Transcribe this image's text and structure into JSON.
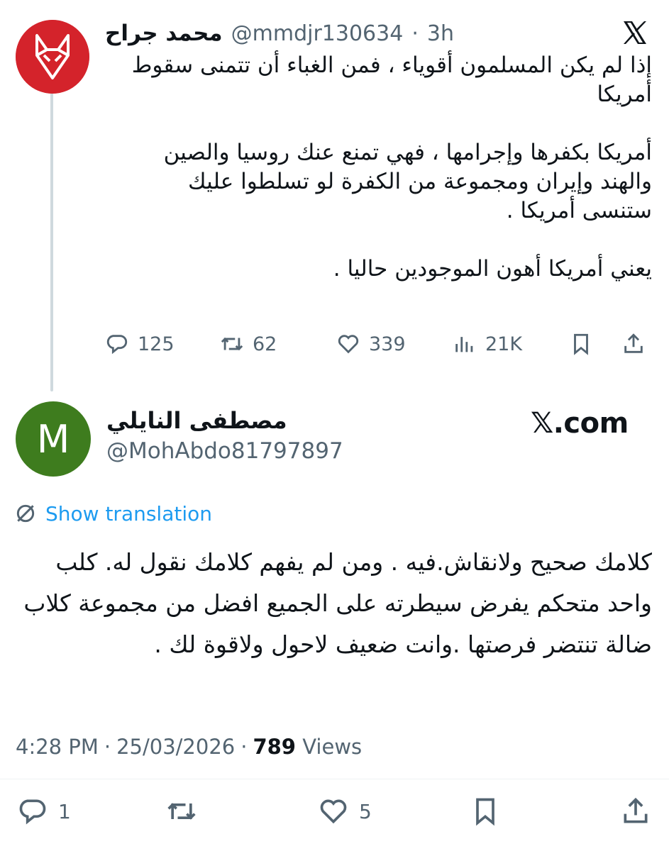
{
  "parent_tweet": {
    "author_name": "محمد جراح",
    "handle": "@mmdjr130634",
    "time": "3h",
    "separator": "·",
    "text": "إذا لم يكن المسلمون أقوياء ، فمن الغباء أن تتمنى سقوط\nأمريكا\n\nأمريكا بكفرها وإجرامها ، فهي تمنع عنك روسيا والصين\nوالهند وإيران ومجموعة من الكفرة لو تسلطوا عليك\nستنسى أمريكا .\n\nيعني أمريكا أهون الموجودين حاليا .",
    "replies": "125",
    "reposts": "62",
    "likes": "339",
    "views": "21K",
    "avatar_color": "#d4232b"
  },
  "reply_tweet": {
    "author_name": "مصطفى النايلي",
    "handle": "@MohAbdo81797897",
    "avatar_letter": "M",
    "avatar_color": "#3e7c1e",
    "source": "𝕏.com",
    "show_translation": "Show translation",
    "text": "كلامك صحيح  ولانقاش.فيه .  ومن لم يفهم كلامك نقول له.  كلب واحد متحكم  يفرض سيطرته على الجميع افضل من مجموعة كلاب ضالة تنتضر فرصتها .وانت ضعيف لاحول ولاقوة لك .",
    "time": "4:28 PM",
    "date": "25/03/2026",
    "separator": "·",
    "views_count": "789",
    "views_label": "Views",
    "replies": "1",
    "likes": "5"
  },
  "icons": [
    "x-logo-icon",
    "reply-icon",
    "repost-icon",
    "like-icon",
    "views-icon",
    "bookmark-icon",
    "share-icon",
    "translate-icon"
  ]
}
